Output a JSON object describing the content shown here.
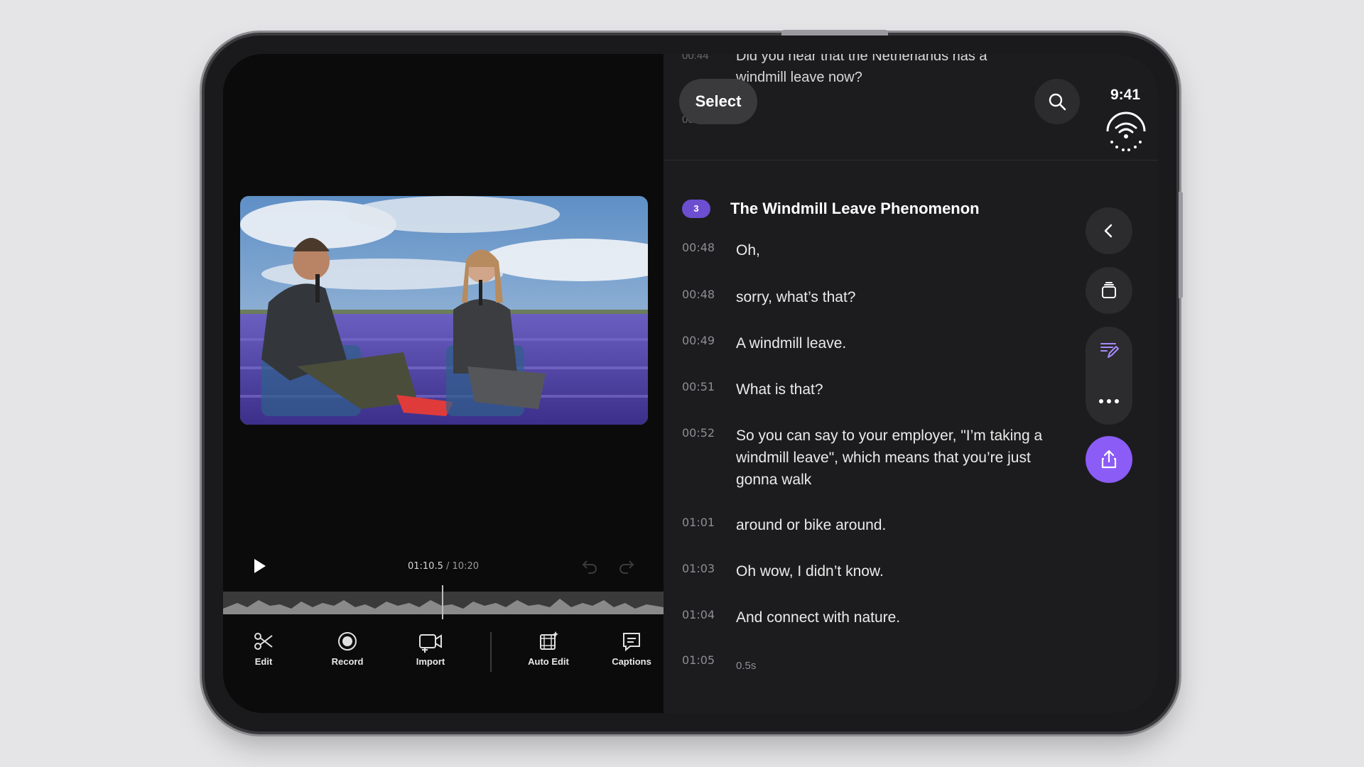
{
  "status": {
    "time": "9:41"
  },
  "player": {
    "current_time": "01:10.5",
    "separator": "/",
    "duration": "10:20"
  },
  "toolbar": {
    "edit": "Edit",
    "record": "Record",
    "import": "Import",
    "auto_edit": "Auto Edit",
    "captions": "Captions"
  },
  "transcript": {
    "ghost_timestamp": "00:44",
    "ghost_text": "Did you hear that the Netherlands has a windmill leave now?",
    "ghost_timestamp_2": "00:47",
    "select_label": "Select",
    "chapter": {
      "number": "3",
      "title": "The Windmill Leave Phenomenon"
    },
    "lines": [
      {
        "time": "00:48",
        "text": "Oh,"
      },
      {
        "time": "00:48",
        "text": "sorry, what’s that?"
      },
      {
        "time": "00:49",
        "text": "A windmill leave."
      },
      {
        "time": "00:51",
        "text": "What is that?"
      },
      {
        "time": "00:52",
        "text": "So you can say to your employer, \"I’m taking a windmill leave\", which means that you’re just gonna walk"
      },
      {
        "time": "01:01",
        "text": "around or bike around."
      },
      {
        "time": "01:03",
        "text": "Oh wow, I didn’t know."
      },
      {
        "time": "01:04",
        "text": "And connect with nature."
      },
      {
        "time": "01:05",
        "text": "0.5s"
      }
    ]
  },
  "icons": {
    "play": "play-icon",
    "undo": "undo-icon",
    "redo": "redo-icon",
    "search": "search-icon",
    "wifi": "wifi-icon",
    "back": "chevron-left-icon",
    "layers": "stack-icon",
    "edit_text": "edit-text-icon",
    "more": "more-icon",
    "export": "share-icon"
  },
  "colors": {
    "accent": "#8b5cf6",
    "chapter_badge": "#6b4fd0",
    "panel": "#1c1c1e",
    "editor": "#0b0b0b"
  }
}
